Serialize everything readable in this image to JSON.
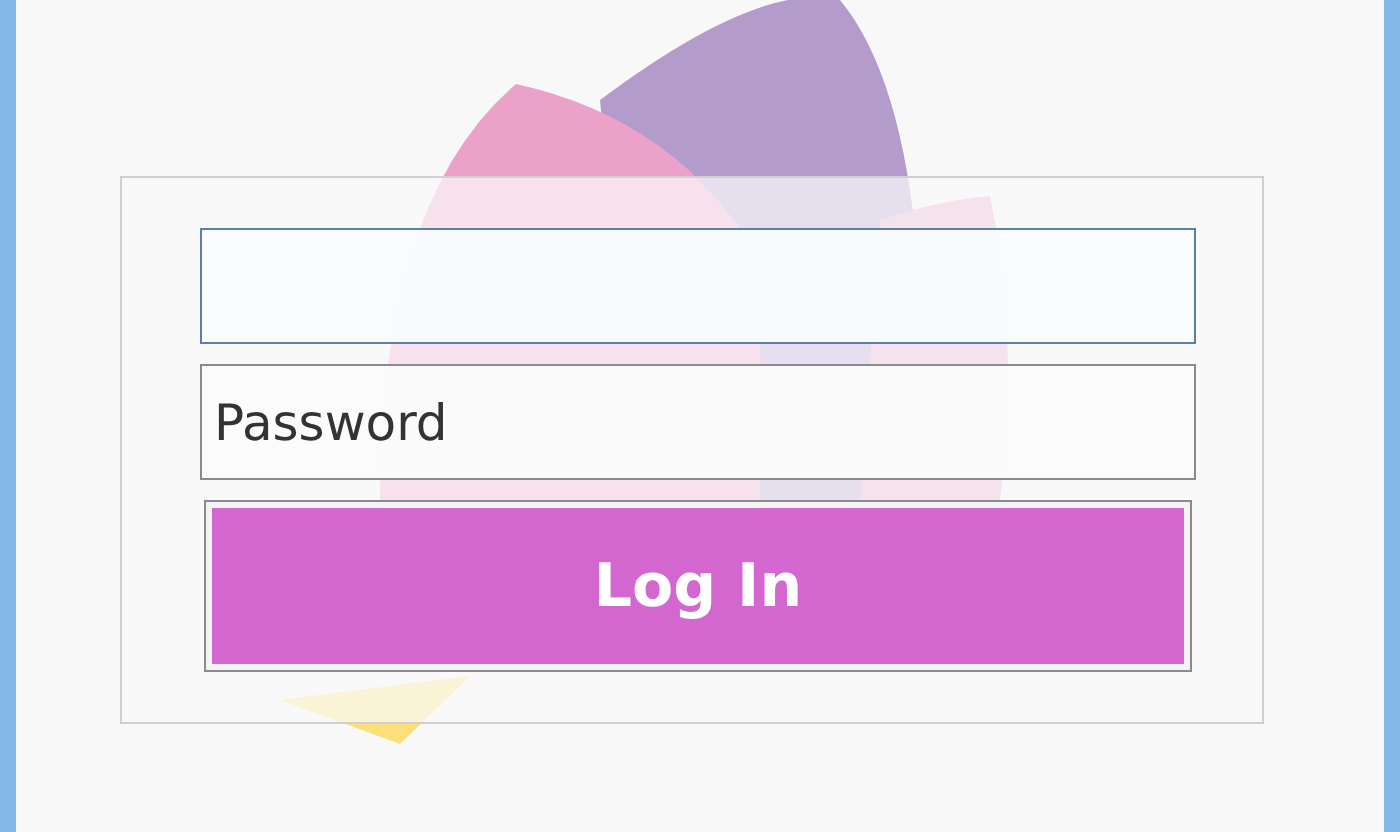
{
  "login_form": {
    "username_field": {
      "focused": true
    },
    "password_field": {
      "placeholder": "Password",
      "focused": false
    },
    "button": {
      "label": "Log In"
    }
  }
}
